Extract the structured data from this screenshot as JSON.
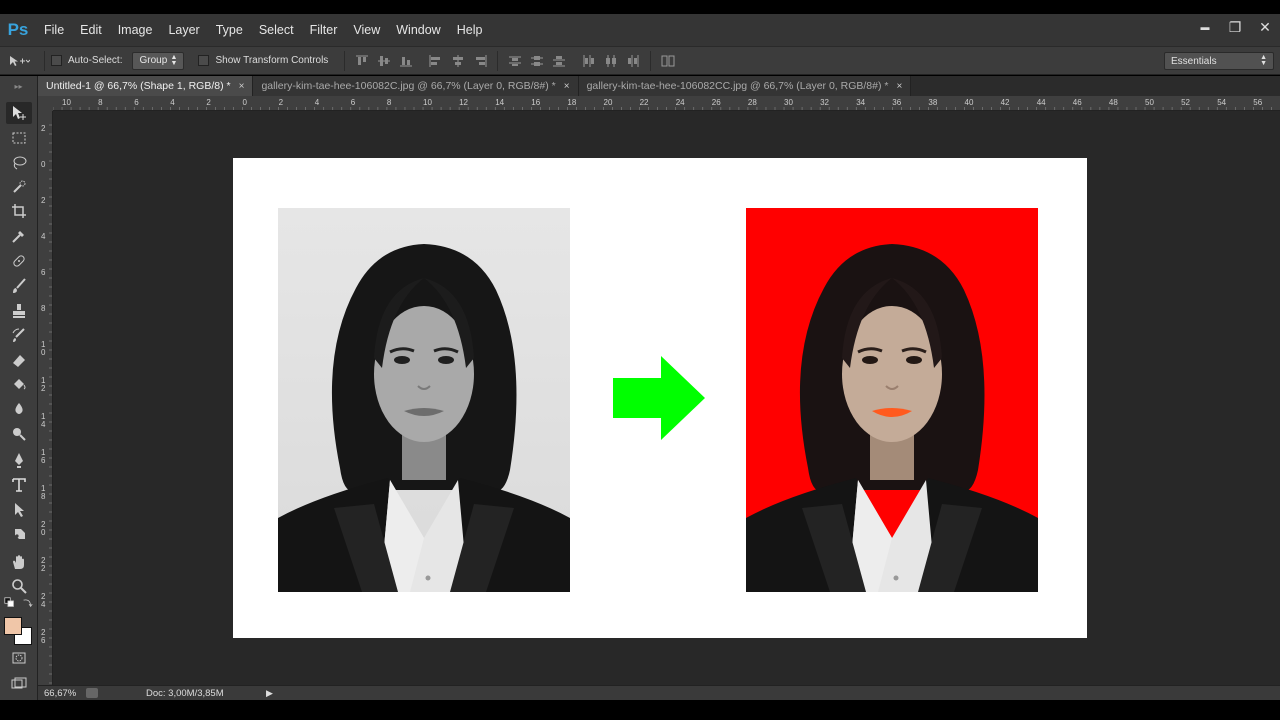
{
  "app": {
    "logo": "Ps"
  },
  "menu": [
    "File",
    "Edit",
    "Image",
    "Layer",
    "Type",
    "Select",
    "Filter",
    "View",
    "Window",
    "Help"
  ],
  "window_controls": {
    "minimize": "▬",
    "restore": "❐",
    "close": "✕"
  },
  "options": {
    "auto_select_label": "Auto-Select:",
    "auto_select_value": "Group",
    "show_transform_label": "Show Transform Controls",
    "workspace": "Essentials"
  },
  "tabs": [
    {
      "label": "Untitled-1 @ 66,7% (Shape 1, RGB/8) *",
      "active": true
    },
    {
      "label": "gallery-kim-tae-hee-106082C.jpg @ 66,7% (Layer 0, RGB/8#) *",
      "active": false
    },
    {
      "label": "gallery-kim-tae-hee-106082CC.jpg @ 66,7% (Layer 0, RGB/8#) *",
      "active": false
    }
  ],
  "tab_close": "×",
  "ruler_h_labels": [
    "10",
    "8",
    "6",
    "4",
    "2",
    "0",
    "2",
    "4",
    "6",
    "8",
    "10",
    "12",
    "14",
    "16",
    "18",
    "20",
    "22",
    "24",
    "26",
    "28",
    "30",
    "32",
    "34",
    "36",
    "38",
    "40",
    "42",
    "44",
    "46",
    "48",
    "50",
    "52",
    "54",
    "56"
  ],
  "ruler_v_labels": [
    "2",
    "0",
    "2",
    "4",
    "6",
    "8",
    "1 0",
    "1 2",
    "1 4",
    "1 6",
    "1 8",
    "2 0",
    "2 2",
    "2 4",
    "2 6"
  ],
  "status": {
    "zoom": "66,67%",
    "doc": "Doc: 3,00M/3,85M"
  },
  "colors": {
    "foreground": "#f0c6a8",
    "background": "#ffffff",
    "arrow": "#00ff00",
    "after_bg": "#ff0000"
  },
  "tools": [
    "move-icon",
    "marquee-icon",
    "lasso-icon",
    "quick-select-icon",
    "crop-icon",
    "eyedropper-icon",
    "healing-brush-icon",
    "brush-icon",
    "clone-stamp-icon",
    "history-brush-icon",
    "eraser-icon",
    "paint-bucket-icon",
    "blur-icon",
    "dodge-icon",
    "pen-icon",
    "type-icon",
    "path-select-icon",
    "shape-icon",
    "hand-icon",
    "zoom-icon"
  ]
}
